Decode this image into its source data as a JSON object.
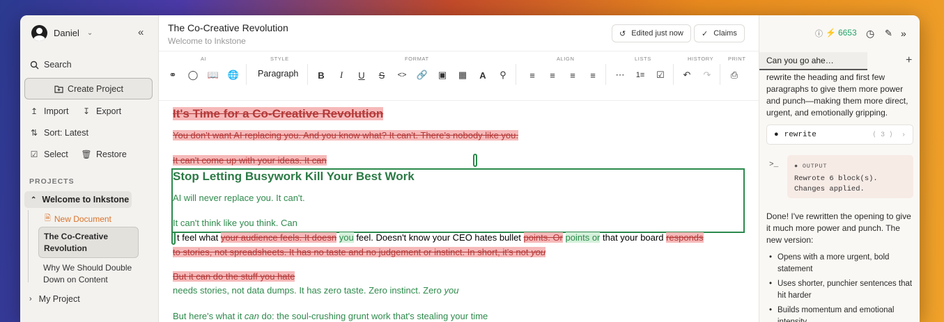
{
  "sidebar": {
    "user": "Daniel",
    "search": "Search",
    "create": "Create Project",
    "import": "Import",
    "export": "Export",
    "sort": "Sort: Latest",
    "select": "Select",
    "restore": "Restore",
    "projects_label": "PROJECTS",
    "project_parent": "Welcome to Inkstone",
    "new_doc": "New Document",
    "active_doc": "The Co-Creative Revolution",
    "other_doc": "Why We Should Double Down on Content",
    "my_project": "My Project"
  },
  "header": {
    "title": "The Co-Creative Revolution",
    "subtitle": "Welcome to Inkstone",
    "edited": "Edited just now",
    "claims": "Claims"
  },
  "toolbar": {
    "groups": {
      "ai": "AI",
      "style": "STYLE",
      "format": "FORMAT",
      "align": "ALIGN",
      "lists": "LISTS",
      "history": "HISTORY",
      "print": "PRINT"
    },
    "paragraph": "Paragraph"
  },
  "editor": {
    "del_heading": "It's Time for a Co-Creative Revolution",
    "del_line1": "You don't want AI replacing you. And you know what? It can't. There's nobody like you.",
    "del_line2": "It can't come up with your ideas. It can",
    "ins_heading": "Stop Letting Busywork Kill Your Best Work",
    "ins_line1": "AI will never replace you. It can't.",
    "ins_line2": "It can't think like you think. Can",
    "mixed": {
      "a": "t feel what ",
      "b": "your audience feels. It doesn",
      "c": "you",
      "d": " feel. Doesn",
      "e": "'t know your CEO hates bullet ",
      "f": "points. Or",
      "g": "points or",
      "h": " that your board ",
      "i": "responds"
    },
    "del_line3": "to stories, not spreadsheets. It has no taste and no judgement or instinct. In short, it's not ",
    "del_line3_em": "you",
    "del_line4": "But it can do the stuff you hate",
    "ins_line3": "needs stories, not data dumps. It has zero taste. Zero instinct. Zero ",
    "ins_line3_em": "you",
    "last_a": "But here's what it ",
    "last_em": "can",
    "last_b": " do: the soul-crushing grunt work that's stealing your time"
  },
  "panel": {
    "credits": "6653",
    "tab": "Can you go ahe…",
    "msg1": "rewrite the heading and first few paragraphs to give them more power and punch—making them more direct, urgent, and emotionally gripping.",
    "tool_name": "rewrite",
    "tool_count": "3",
    "output_label": "OUTPUT",
    "output_text": "Rewrote 6 block(s). Changes applied.",
    "done": "Done! I've rewritten the opening to give it much more power and punch. The new version:",
    "bullets": [
      "Opens with a more urgent, bold statement",
      "Uses shorter, punchier sentences that hit harder",
      "Builds momentum and emotional intensity"
    ]
  },
  "colors": {
    "insert": "#2e8a4c",
    "delete_bg": "#f6b9b9",
    "delete_text": "#b43a3a",
    "accent": "#2b8a4c",
    "credits": "#23a36a"
  }
}
